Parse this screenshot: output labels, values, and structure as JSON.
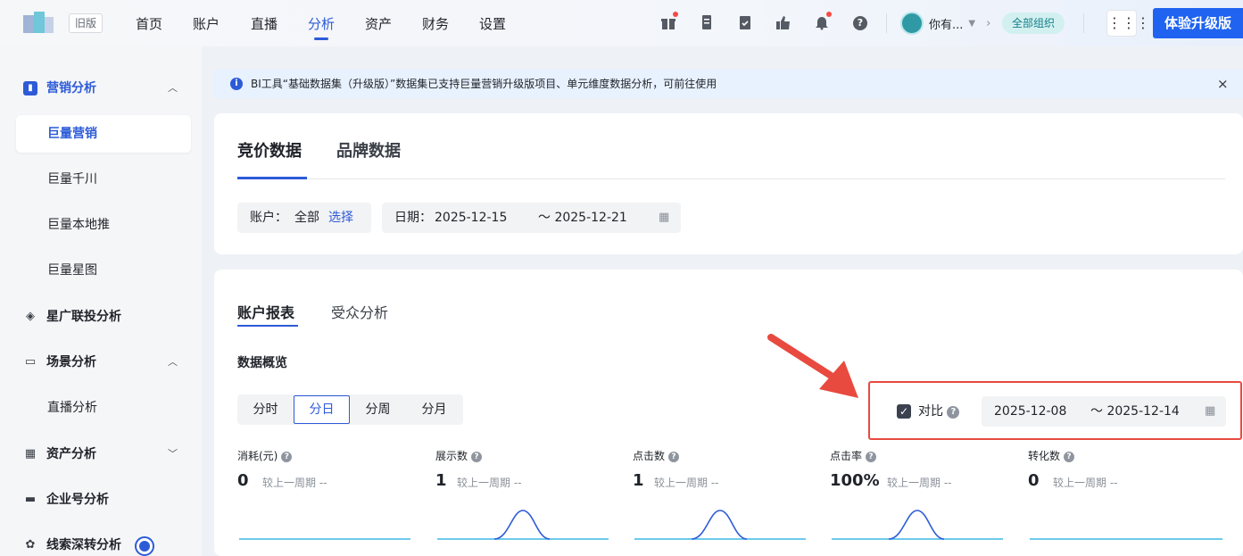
{
  "topbar": {
    "old_version": "旧版",
    "nav": [
      "首页",
      "账户",
      "直播",
      "分析",
      "资产",
      "财务",
      "设置"
    ],
    "active_nav": "分析",
    "user_name": "你有...",
    "org_tag": "全部组织",
    "grid_icon": "apps-grid-icon",
    "upgrade_label": "体验升级版",
    "icons": [
      "gift-icon",
      "document-icon",
      "clipboard-check-icon",
      "thumb-icon",
      "bell-icon",
      "help-icon"
    ]
  },
  "sidebar": {
    "group1": {
      "label": "营销分析",
      "icon": "chart-icon"
    },
    "subitems1": [
      "巨量营销",
      "巨量千川",
      "巨量本地推",
      "巨量星图"
    ],
    "selected_sub": "巨量营销",
    "item_xingguang": "星广联投分析",
    "group2": {
      "label": "场景分析"
    },
    "subitems2": [
      "直播分析"
    ],
    "item_asset": "资产分析",
    "item_enterprise": "企业号分析",
    "item_leads": "线索深转分析"
  },
  "notice": {
    "text": "BI工具“基础数据集（升级版）”数据集已支持巨量营销升级版项目、单元维度数据分析，可前往使用",
    "close": "×"
  },
  "card1": {
    "tabs": [
      "竞价数据",
      "品牌数据"
    ],
    "active_tab": "竞价数据",
    "account_label": "账户：",
    "account_value": "全部",
    "account_select": "选择",
    "date_label": "日期：",
    "date_start": "2025-12-15",
    "date_end": "～ 2025-12-21"
  },
  "card2": {
    "tabs": [
      "账户报表",
      "受众分析"
    ],
    "active_tab": "账户报表",
    "section_title": "数据概览",
    "granularity": [
      "分时",
      "分日",
      "分周",
      "分月"
    ],
    "selected_granularity": "分日",
    "compare": {
      "checked": true,
      "label": "对比",
      "date_start": "2025-12-08",
      "date_end": "～ 2025-12-14"
    },
    "metrics": [
      {
        "name": "消耗(元)",
        "value": "0",
        "compare": "较上一周期 --",
        "peak": false
      },
      {
        "name": "展示数",
        "value": "1",
        "compare": "较上一周期 --",
        "peak": true
      },
      {
        "name": "点击数",
        "value": "1",
        "compare": "较上一周期 --",
        "peak": true
      },
      {
        "name": "点击率",
        "value": "100%",
        "compare": "较上一周期 --",
        "peak": true
      },
      {
        "name": "转化数",
        "value": "0",
        "compare": "较上一周期 --",
        "peak": false
      }
    ]
  },
  "colors": {
    "primary": "#2d5bd8",
    "upgrade_btn": "#1f63f0",
    "highlight_box": "#e84a3f",
    "org_tag_bg": "#d3f0f1",
    "notice_bg": "#e8f1fe"
  }
}
